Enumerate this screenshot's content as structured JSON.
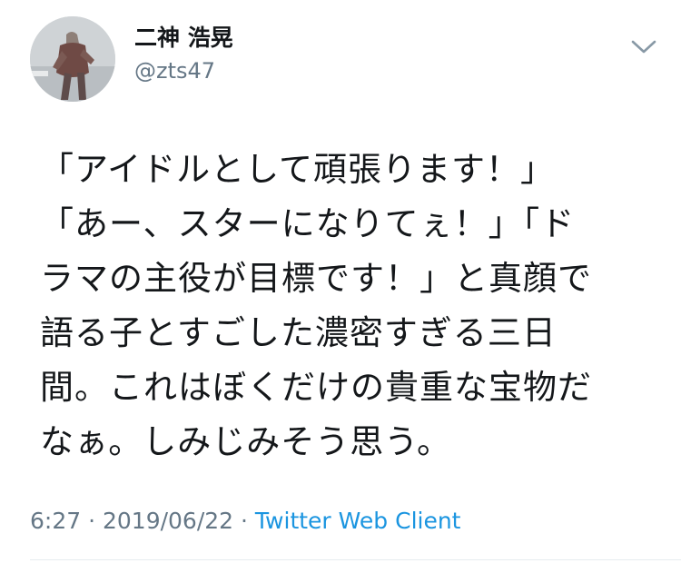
{
  "user": {
    "display_name": "二神 浩晃",
    "handle": "@zts47"
  },
  "tweet": {
    "lines": [
      "「アイドルとして頑張ります！」",
      "「あー、スターになりてぇ！」「ド",
      "ラマの主役が目標です！」と真顔で",
      "語る子とすごした濃密すぎる三日",
      "間。これはぼくだけの貴重な宝物だ",
      "なぁ。しみじみそう思う。"
    ],
    "time": "6:27",
    "separator": " · ",
    "date": "2019/06/22",
    "source": "Twitter Web Client"
  },
  "icons": {
    "menu": "chevron-down-icon",
    "avatar": "avatar"
  },
  "colors": {
    "text": "#14171a",
    "secondary": "#657786",
    "link": "#1b95e0",
    "divider": "#e6ecf0"
  }
}
